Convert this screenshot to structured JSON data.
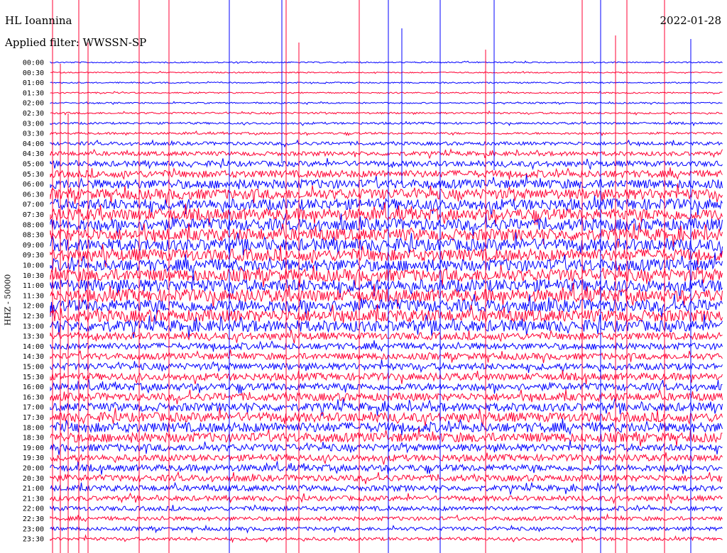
{
  "header": {
    "station": "HL Ioannina",
    "filter": "Applied filter: WWSSN-SP",
    "date": "2022-01-28"
  },
  "side_label": "HHZ - 50000",
  "chart_data": {
    "type": "line",
    "title": "HL Ioannina",
    "subtitle": "Applied filter: WWSSN-SP",
    "date": "2022-01-28",
    "ylabel": "HHZ - 50000",
    "grid": false,
    "colors": {
      "even": "#0000ff",
      "odd": "#ff0033"
    },
    "rows": [
      {
        "label": "00:00",
        "amp": 0.1
      },
      {
        "label": "00:30",
        "amp": 0.09
      },
      {
        "label": "01:00",
        "amp": 0.1
      },
      {
        "label": "01:30",
        "amp": 0.1
      },
      {
        "label": "02:00",
        "amp": 0.11
      },
      {
        "label": "02:30",
        "amp": 0.14
      },
      {
        "label": "03:00",
        "amp": 0.16
      },
      {
        "label": "03:30",
        "amp": 0.16
      },
      {
        "label": "04:00",
        "amp": 0.26
      },
      {
        "label": "04:30",
        "amp": 0.33
      },
      {
        "label": "05:00",
        "amp": 0.42
      },
      {
        "label": "05:30",
        "amp": 0.55
      },
      {
        "label": "06:00",
        "amp": 0.7
      },
      {
        "label": "06:30",
        "amp": 0.8
      },
      {
        "label": "07:00",
        "amp": 0.86
      },
      {
        "label": "07:30",
        "amp": 0.9
      },
      {
        "label": "08:00",
        "amp": 0.92
      },
      {
        "label": "08:30",
        "amp": 0.94
      },
      {
        "label": "09:00",
        "amp": 0.94
      },
      {
        "label": "09:30",
        "amp": 0.92
      },
      {
        "label": "10:00",
        "amp": 0.92
      },
      {
        "label": "10:30",
        "amp": 0.95
      },
      {
        "label": "11:00",
        "amp": 0.95
      },
      {
        "label": "11:30",
        "amp": 0.96
      },
      {
        "label": "12:00",
        "amp": 0.95
      },
      {
        "label": "12:30",
        "amp": 0.93
      },
      {
        "label": "13:00",
        "amp": 0.88
      },
      {
        "label": "13:30",
        "amp": 0.55
      },
      {
        "label": "14:00",
        "amp": 0.5
      },
      {
        "label": "14:30",
        "amp": 0.5
      },
      {
        "label": "15:00",
        "amp": 0.52
      },
      {
        "label": "15:30",
        "amp": 0.55
      },
      {
        "label": "16:00",
        "amp": 0.56
      },
      {
        "label": "16:30",
        "amp": 0.6
      },
      {
        "label": "17:00",
        "amp": 0.65
      },
      {
        "label": "17:30",
        "amp": 0.72
      },
      {
        "label": "18:00",
        "amp": 0.75
      },
      {
        "label": "18:30",
        "amp": 0.72
      },
      {
        "label": "19:00",
        "amp": 0.55
      },
      {
        "label": "19:30",
        "amp": 0.5
      },
      {
        "label": "20:00",
        "amp": 0.5
      },
      {
        "label": "20:30",
        "amp": 0.48
      },
      {
        "label": "21:00",
        "amp": 0.44
      },
      {
        "label": "21:30",
        "amp": 0.38
      },
      {
        "label": "22:00",
        "amp": 0.34
      },
      {
        "label": "22:30",
        "amp": 0.3
      },
      {
        "label": "23:00",
        "amp": 0.28
      },
      {
        "label": "23:30",
        "amp": 0.25
      }
    ]
  }
}
